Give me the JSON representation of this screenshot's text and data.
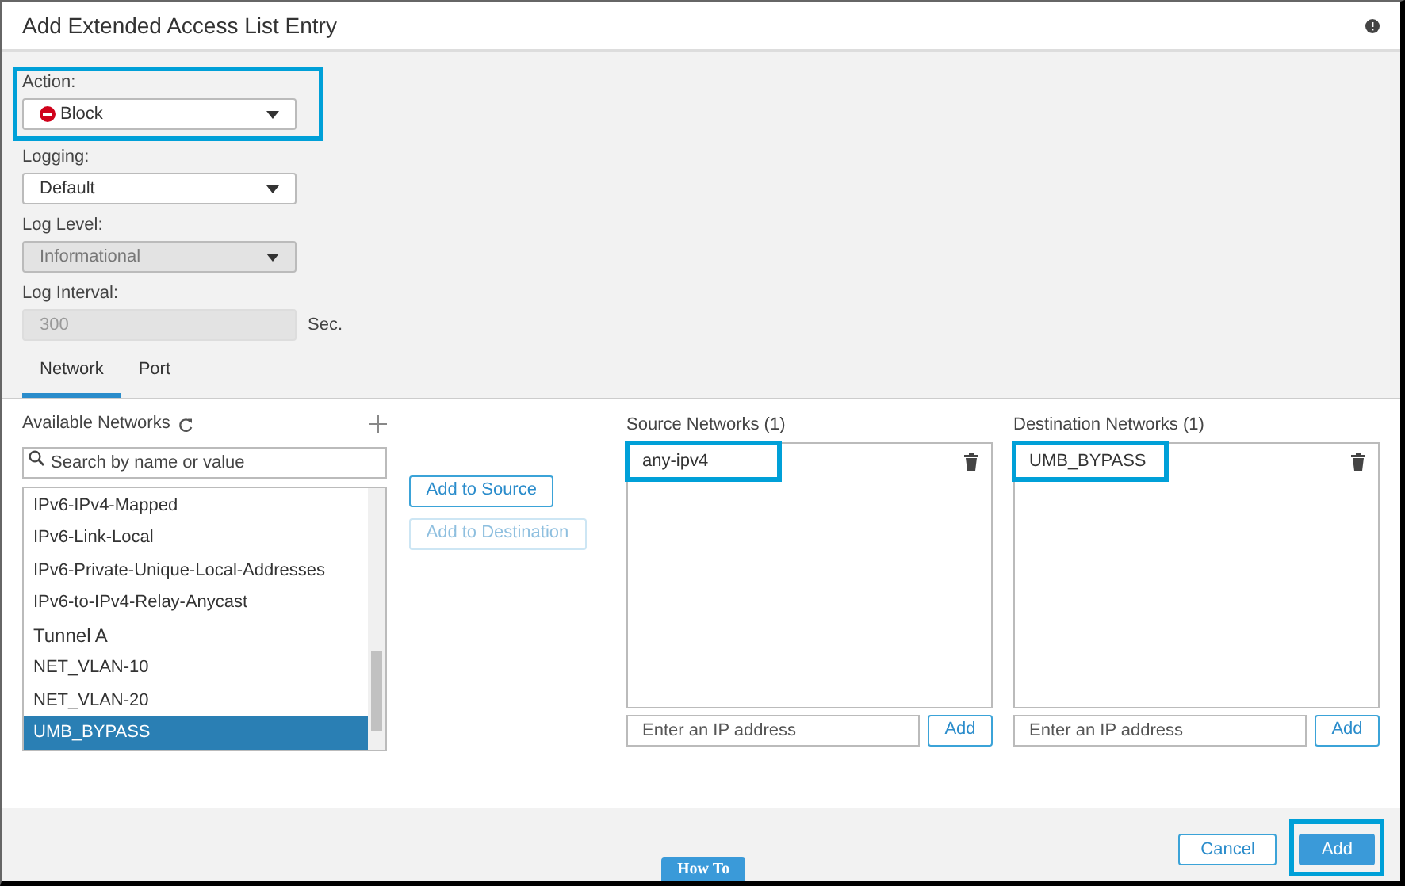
{
  "window": {
    "title": "Add Extended Access List Entry"
  },
  "fields": [
    {
      "label": "Action:",
      "kind": "action",
      "value": "Block",
      "disabled": false,
      "highlighted": true
    },
    {
      "label": "Logging:",
      "kind": "select",
      "value": "Default",
      "disabled": false,
      "highlighted": false
    },
    {
      "label": "Log Level:",
      "kind": "select",
      "value": "Informational",
      "disabled": true,
      "highlighted": false
    },
    {
      "label": "Log Interval:",
      "kind": "input",
      "value": "300",
      "unit": "Sec.",
      "disabled": true,
      "highlighted": false
    }
  ],
  "tabs": [
    {
      "label": "Network",
      "selected": true
    },
    {
      "label": "Port",
      "selected": false
    }
  ],
  "available_networks": {
    "title": "Available Networks",
    "search": {
      "placeholder": "Search by name or value"
    },
    "items": [
      {
        "label": "IPv6-IPv4-Mapped",
        "kind": "item",
        "selected": false
      },
      {
        "label": "IPv6-Link-Local",
        "kind": "item",
        "selected": false
      },
      {
        "label": "IPv6-Private-Unique-Local-Addresses",
        "kind": "item",
        "selected": false
      },
      {
        "label": "IPv6-to-IPv4-Relay-Anycast",
        "kind": "item",
        "selected": false
      },
      {
        "label": "Tunnel A",
        "kind": "group",
        "selected": false
      },
      {
        "label": "NET_VLAN-10",
        "kind": "item",
        "selected": false
      },
      {
        "label": "NET_VLAN-20",
        "kind": "item",
        "selected": false
      },
      {
        "label": "UMB_BYPASS",
        "kind": "item",
        "selected": true
      }
    ]
  },
  "move_buttons": [
    {
      "label": "Add to Source",
      "disabled": false
    },
    {
      "label": "Add to Destination",
      "disabled": true
    }
  ],
  "panels": [
    {
      "title": "Source Networks (1)",
      "items": [
        {
          "label": "any-ipv4",
          "highlighted": true
        }
      ],
      "ip_field": {
        "placeholder": "Enter an IP address"
      },
      "add_button": "Add"
    },
    {
      "title": "Destination Networks (1)",
      "items": [
        {
          "label": "UMB_BYPASS",
          "highlighted": true
        }
      ],
      "ip_field": {
        "placeholder": "Enter an IP address"
      },
      "add_button": "Add"
    }
  ],
  "footer": {
    "buttons": [
      {
        "label": "Cancel",
        "kind": "secondary",
        "highlighted": false
      },
      {
        "label": "Add",
        "kind": "primary",
        "highlighted": true
      }
    ],
    "how_to": "How To"
  }
}
